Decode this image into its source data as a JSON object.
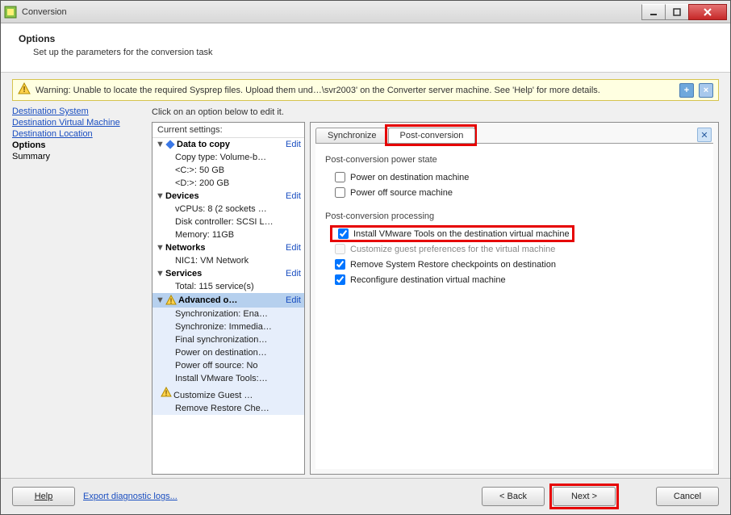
{
  "window": {
    "title": "Conversion"
  },
  "header": {
    "title": "Options",
    "subtitle": "Set up the parameters for the conversion task"
  },
  "warning": {
    "text": "Warning: Unable to locate the required Sysprep files. Upload them und…\\svr2003' on the Converter server machine. See 'Help' for more details.",
    "expand_label": "+",
    "close_label": "×"
  },
  "nav": {
    "items": [
      {
        "label": "Destination System",
        "link": true
      },
      {
        "label": "Destination Virtual Machine",
        "link": true
      },
      {
        "label": "Destination Location",
        "link": true
      },
      {
        "label": "Options",
        "current": true
      },
      {
        "label": "Summary",
        "plain": true
      }
    ]
  },
  "content": {
    "hint": "Click on an option below to edit it.",
    "settings_head": "Current settings:",
    "edit_label": "Edit",
    "groups": [
      {
        "name": "Data to copy",
        "icon": "diamond",
        "items": [
          "Copy type: Volume-b…",
          "<C:>: 50 GB",
          "<D:>: 200 GB"
        ]
      },
      {
        "name": "Devices",
        "items": [
          "vCPUs: 8 (2 sockets …",
          "Disk controller: SCSI L…",
          "Memory: 11GB"
        ]
      },
      {
        "name": "Networks",
        "items": [
          "NIC1: VM Network"
        ]
      },
      {
        "name": "Services",
        "items": [
          "Total: 115 service(s)"
        ]
      },
      {
        "name": "Advanced o…",
        "icon": "warn",
        "selected": true,
        "items": [
          "Synchronization: Ena…",
          "Synchronize: Immedia…",
          "Final synchronization…",
          "Power on destination…",
          "Power off source: No",
          "Install VMware Tools:…",
          "Customize Guest …",
          "Remove Restore Che…"
        ],
        "item_warn_index": 6
      }
    ]
  },
  "detail": {
    "tabs": [
      {
        "label": "Synchronize",
        "active": false
      },
      {
        "label": "Post-conversion",
        "active": true
      }
    ],
    "section1_label": "Post-conversion power state",
    "section1_checks": [
      {
        "label": "Power on destination machine",
        "checked": false
      },
      {
        "label": "Power off source machine",
        "checked": false
      }
    ],
    "section2_label": "Post-conversion processing",
    "section2_checks": [
      {
        "label": "Install VMware Tools on the destination virtual machine",
        "checked": true,
        "emph": true
      },
      {
        "label": "Customize guest preferences for the virtual machine",
        "checked": false,
        "disabled": true
      },
      {
        "label": "Remove System Restore checkpoints on destination",
        "checked": true
      },
      {
        "label": "Reconfigure destination virtual machine",
        "checked": true
      }
    ]
  },
  "footer": {
    "help": "Help",
    "export": "Export diagnostic logs...",
    "back": "< Back",
    "next": "Next >",
    "cancel": "Cancel"
  }
}
